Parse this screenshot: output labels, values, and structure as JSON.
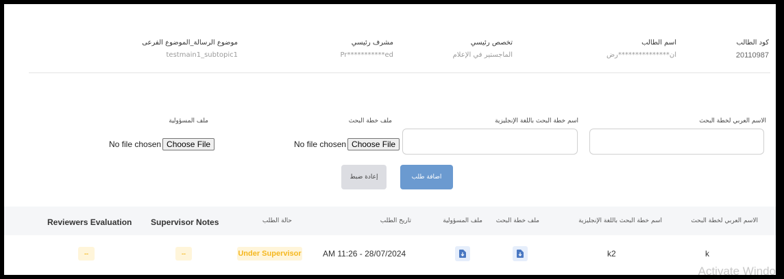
{
  "info": {
    "student_code_label": "كود الطالب",
    "student_code_value": "20110987",
    "student_name_label": "اسم الطالب",
    "student_name_value": "ان***************رض",
    "main_specialty_label": "تخصص رئيسي",
    "main_specialty_value": "الماجستير في الإعلام",
    "main_supervisor_label": "مشرف رئيسي",
    "main_supervisor_value": "Pr***********ed",
    "thesis_subject_label": "موضوع الرسالة_الموضوع الفرعى",
    "thesis_subject_value": "testmain1_subtopic1"
  },
  "form": {
    "arabic_name_label": "الاسم العربي لخطة البحث",
    "english_name_label": "اسم خطة البحث باللغة الإنجليزية",
    "plan_file_label": "ملف خطة البحث",
    "responsibility_file_label": "ملف المسؤولية",
    "no_file_text": "No file chosen",
    "choose_file_label": "Choose File",
    "reset_label": "إعادة ضبط",
    "add_label": "اضافة طلب"
  },
  "table": {
    "headers": {
      "arabic_name": "الاسم العربي لخطة البحث",
      "english_name": "اسم خطة البحث باللغة الإنجليزية",
      "plan_file": "ملف خطة البحث",
      "responsibility_file": "ملف المسؤولية",
      "request_date": "تاريخ الطلب",
      "request_status": "حالة الطلب",
      "supervisor_notes": "Supervisor Notes",
      "reviewers_evaluation": "Reviewers Evaluation"
    },
    "row": {
      "arabic_name": "k",
      "english_name": "k2",
      "request_date": "AM 11:26 - 28/07/2024",
      "request_status": "Under Supervisor",
      "supervisor_notes": "--",
      "reviewers_evaluation": "--"
    },
    "icons": {
      "plan_file": "download-icon",
      "responsibility_file": "download-icon"
    }
  },
  "watermark": "Activate Windo",
  "colors": {
    "primary_button": "#6b9ad0",
    "reset_button": "#dcdde2",
    "badge_bg": "#fff5da",
    "badge_text": "#f5b820",
    "download_bg": "#e6eefb"
  }
}
